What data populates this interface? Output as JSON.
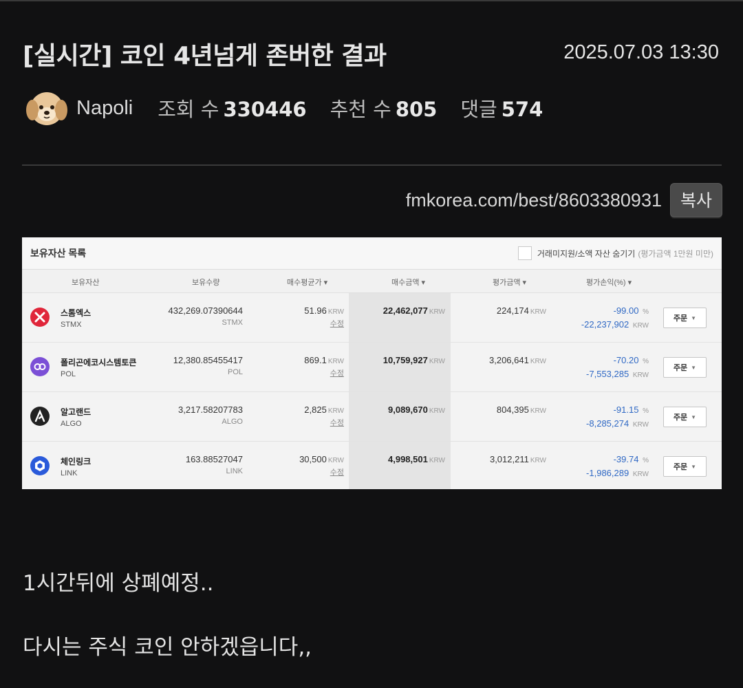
{
  "post": {
    "title": "[실시간] 코인 4년넘게 존버한 결과",
    "datetime": "2025.07.03 13:30",
    "author": "Napoli",
    "views_label": "조회 수",
    "views": "330446",
    "recommend_label": "추천 수",
    "recommend": "805",
    "comments_label": "댓글",
    "comments": "574",
    "url": "fmkorea.com/best/8603380931",
    "copy_label": "복사",
    "body_line1": "1시간뒤에 상폐예정..",
    "body_line2": "다시는 주식 코인 안하겠읍니다,,"
  },
  "screenshot": {
    "title": "보유자산 목록",
    "hide_option": "거래미지원/소액 자산 숨기기",
    "hide_note": "(평가금액 1만원 미만)",
    "columns": [
      "보유자산",
      "보유수량",
      "매수평균가 ▾",
      "매수금액 ▾",
      "평가금액 ▾",
      "평가손익(%) ▾"
    ],
    "unit": "KRW",
    "edit_label": "수정",
    "order_label": "주문",
    "percent_sign": "%",
    "rows": [
      {
        "name": "스톰엑스",
        "symbol": "STMX",
        "qty": "432,269.07390644",
        "avg": "51.96",
        "buy": "22,462,077",
        "eval": "224,174",
        "pct": "-99.00",
        "loss": "-22,237,902",
        "icon": "stmx-icon",
        "color": "#e0263a"
      },
      {
        "name": "폴리곤에코시스템토큰",
        "symbol": "POL",
        "qty": "12,380.85455417",
        "avg": "869.1",
        "buy": "10,759,927",
        "eval": "3,206,641",
        "pct": "-70.20",
        "loss": "-7,553,285",
        "icon": "pol-icon",
        "color": "#7b4fd6"
      },
      {
        "name": "알고랜드",
        "symbol": "ALGO",
        "qty": "3,217.58207783",
        "avg": "2,825",
        "buy": "9,089,670",
        "eval": "804,395",
        "pct": "-91.15",
        "loss": "-8,285,274",
        "icon": "algo-icon",
        "color": "#222222"
      },
      {
        "name": "체인링크",
        "symbol": "LINK",
        "qty": "163.88527047",
        "avg": "30,500",
        "buy": "4,998,501",
        "eval": "3,012,211",
        "pct": "-39.74",
        "loss": "-1,986,289",
        "icon": "link-icon",
        "color": "#2a5ada"
      }
    ]
  }
}
